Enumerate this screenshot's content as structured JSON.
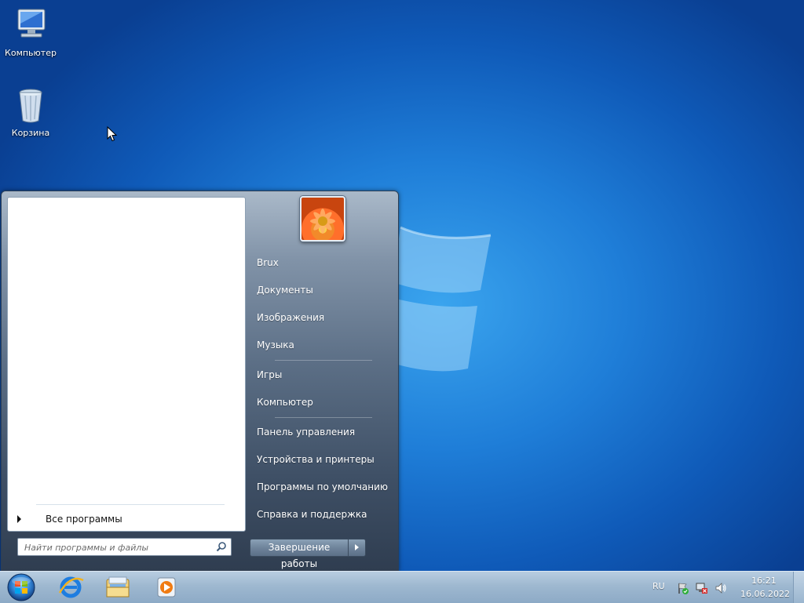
{
  "desktop": {
    "icons": [
      {
        "label": "Компьютер",
        "icon": "computer-icon"
      },
      {
        "label": "Корзина",
        "icon": "recycle-bin-icon"
      }
    ]
  },
  "start_menu": {
    "all_programs": "Все программы",
    "search_placeholder": "Найти программы и файлы",
    "user_name": "Brux",
    "right_items": [
      "Brux",
      "Документы",
      "Изображения",
      "Музыка",
      "Игры",
      "Компьютер",
      "Панель управления",
      "Устройства и принтеры",
      "Программы по умолчанию",
      "Справка и поддержка"
    ],
    "shutdown_label": "Завершение работы"
  },
  "taskbar": {
    "pinned": [
      {
        "icon": "internet-explorer-icon"
      },
      {
        "icon": "windows-explorer-icon"
      },
      {
        "icon": "media-player-icon"
      }
    ],
    "language": "RU",
    "time": "16:21",
    "date": "16.06.2022"
  }
}
